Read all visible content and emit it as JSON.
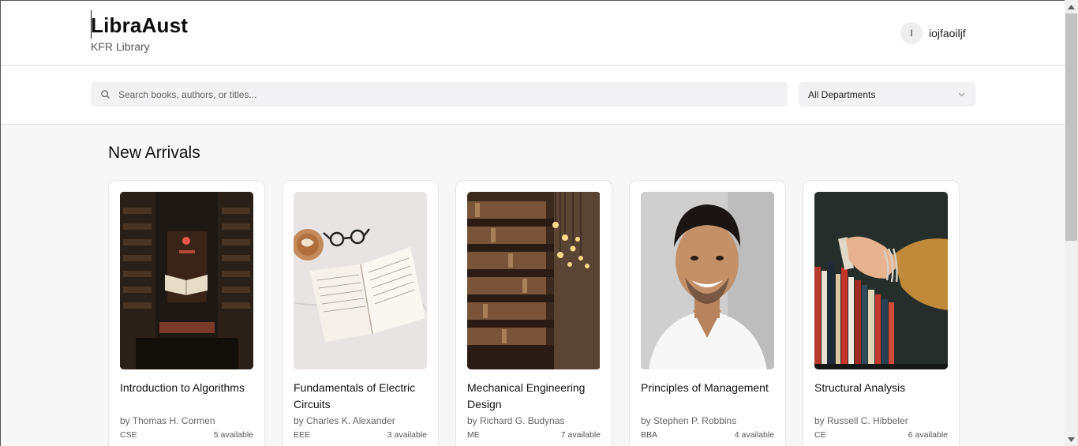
{
  "header": {
    "title": "LibraAust",
    "subtitle": "KFR Library",
    "user_initial": "I",
    "username": "iojfaoiljf"
  },
  "search": {
    "placeholder": "Search books, authors, or titles...",
    "department_selected": "All Departments"
  },
  "section": {
    "title": "New Arrivals"
  },
  "books": [
    {
      "title": "Introduction to Algorithms",
      "author": "by Thomas H. Cormen",
      "dept": "CSE",
      "available": "5 available",
      "cover": "library-tunnel-image"
    },
    {
      "title": "Fundamentals of Electric Circuits",
      "author": "by Charles K. Alexander",
      "dept": "EEE",
      "available": "3 available",
      "cover": "open-book-coffee-image"
    },
    {
      "title": "Mechanical Engineering Design",
      "author": "by Richard G. Budynas",
      "dept": "ME",
      "available": "7 available",
      "cover": "bookshelf-lights-image"
    },
    {
      "title": "Principles of Management",
      "author": "by Stephen P. Robbins",
      "dept": "BBA",
      "available": "4 available",
      "cover": "portrait-man-image"
    },
    {
      "title": "Structural Analysis",
      "author": "by Russell C. Hibbeler",
      "dept": "CE",
      "available": "6 available",
      "cover": "hand-picking-book-image"
    }
  ],
  "colors": {
    "accent": "#0c0c0c",
    "field_bg": "#f2f2f4",
    "page_bg": "#f7f7f7"
  }
}
